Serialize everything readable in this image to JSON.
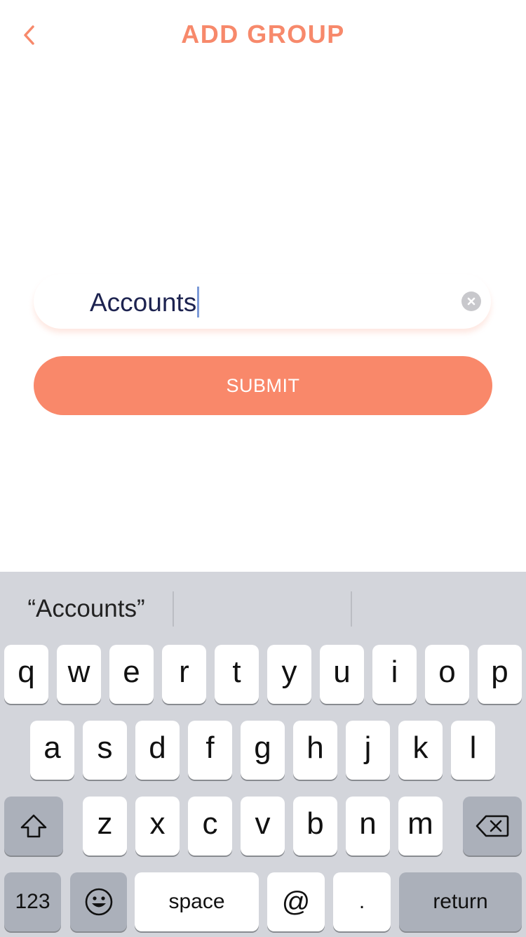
{
  "header": {
    "title": "ADD GROUP",
    "back_icon": "chevron-left-icon"
  },
  "form": {
    "group_name_value": "Accounts",
    "clear_icon": "clear-circle-icon",
    "submit_label": "SUBMIT"
  },
  "keyboard": {
    "suggestions": [
      "“Accounts”",
      "",
      ""
    ],
    "row1": [
      "q",
      "w",
      "e",
      "r",
      "t",
      "y",
      "u",
      "i",
      "o",
      "p"
    ],
    "row2": [
      "a",
      "s",
      "d",
      "f",
      "g",
      "h",
      "j",
      "k",
      "l"
    ],
    "row3": [
      "z",
      "x",
      "c",
      "v",
      "b",
      "n",
      "m"
    ],
    "shift_icon": "shift-icon",
    "delete_icon": "backspace-icon",
    "numbers_label": "123",
    "emoji_icon": "emoji-icon",
    "space_label": "space",
    "at_label": "@",
    "period_label": ".",
    "return_label": "return"
  },
  "colors": {
    "accent": "#f9886a",
    "title": "#f7896b",
    "input_text": "#1d2350",
    "keyboard_bg": "#d3d5db"
  }
}
